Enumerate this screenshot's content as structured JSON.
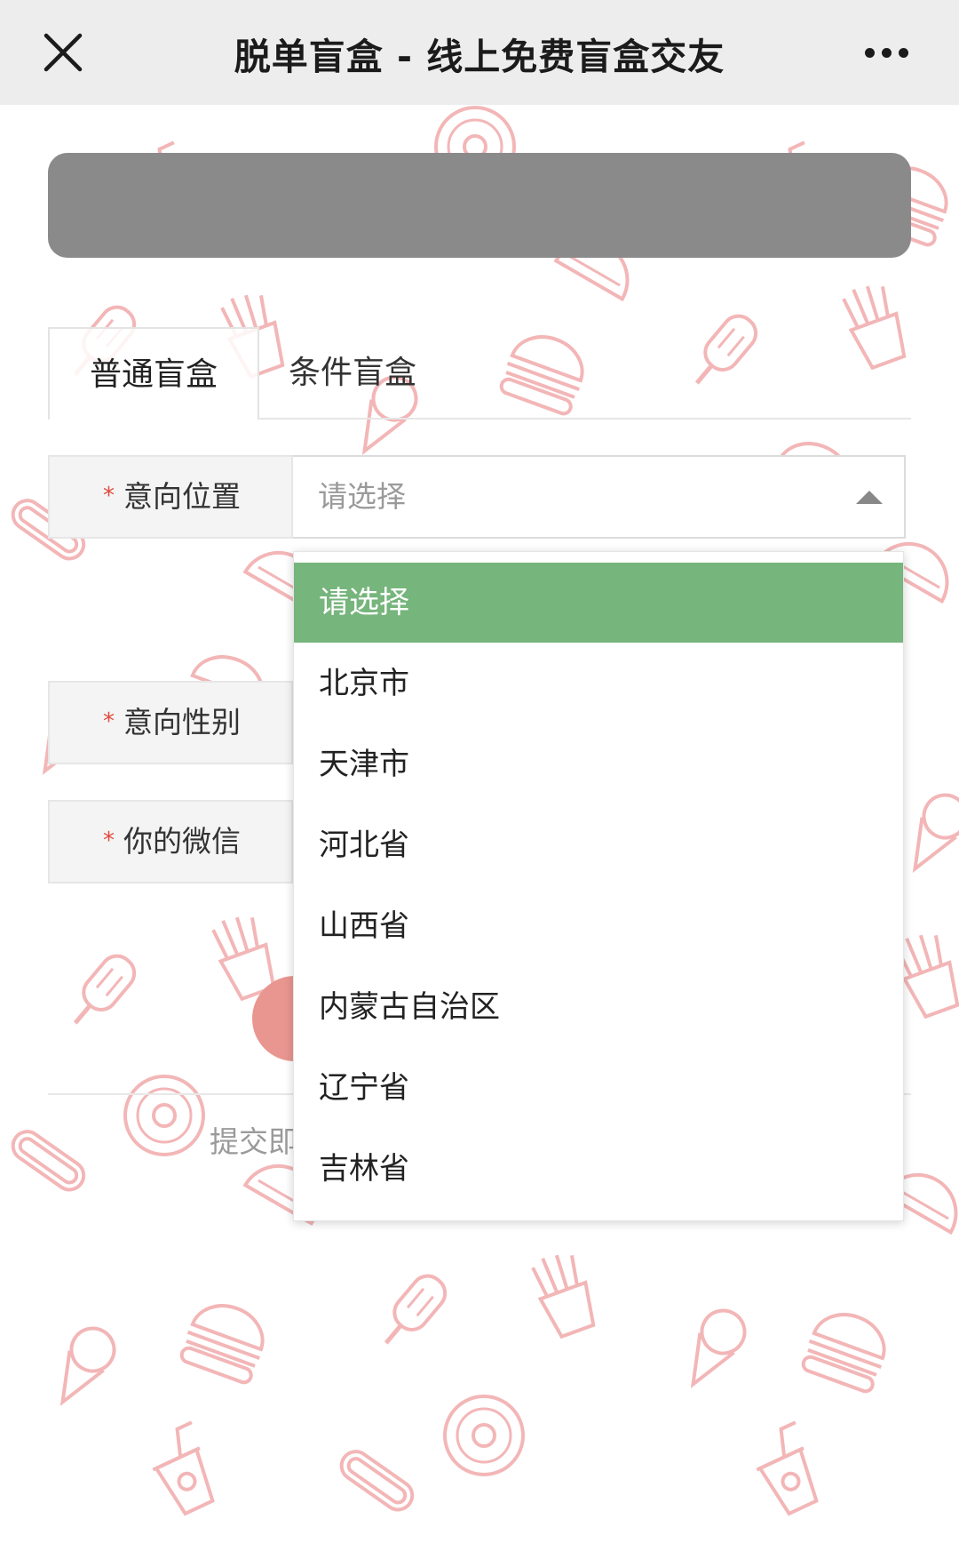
{
  "topbar": {
    "title": "脱单盲盒 - 线上免费盲盒交友",
    "close_icon": "close-icon",
    "more_icon": "more-dots-icon"
  },
  "tabs": [
    {
      "label": "普通盲盒",
      "active": true
    },
    {
      "label": "条件盲盒",
      "active": false
    }
  ],
  "form": {
    "required_mark": "*",
    "location": {
      "label": "意向位置",
      "placeholder": "请选择"
    },
    "gender": {
      "label": "意向性别"
    },
    "wechat": {
      "label": "你的微信"
    },
    "hint_text": "提交即"
  },
  "dropdown": {
    "selected_index": 0,
    "options": [
      "请选择",
      "北京市",
      "天津市",
      "河北省",
      "山西省",
      "内蒙古自治区",
      "辽宁省",
      "吉林省"
    ]
  },
  "colors": {
    "topbar_bg": "#ededed",
    "banner_bg": "#8a8a8a",
    "pattern": "#ef9ea0",
    "selected_option": "#76b57c",
    "required": "#e04a3c",
    "submit_button": "#e99690"
  },
  "background_pattern_icons": [
    "soda-cup-icon",
    "hotdog-icon",
    "donut-icon",
    "taco-icon",
    "fries-icon",
    "popsicle-icon",
    "burger-icon",
    "ice-cream-cone-icon"
  ]
}
